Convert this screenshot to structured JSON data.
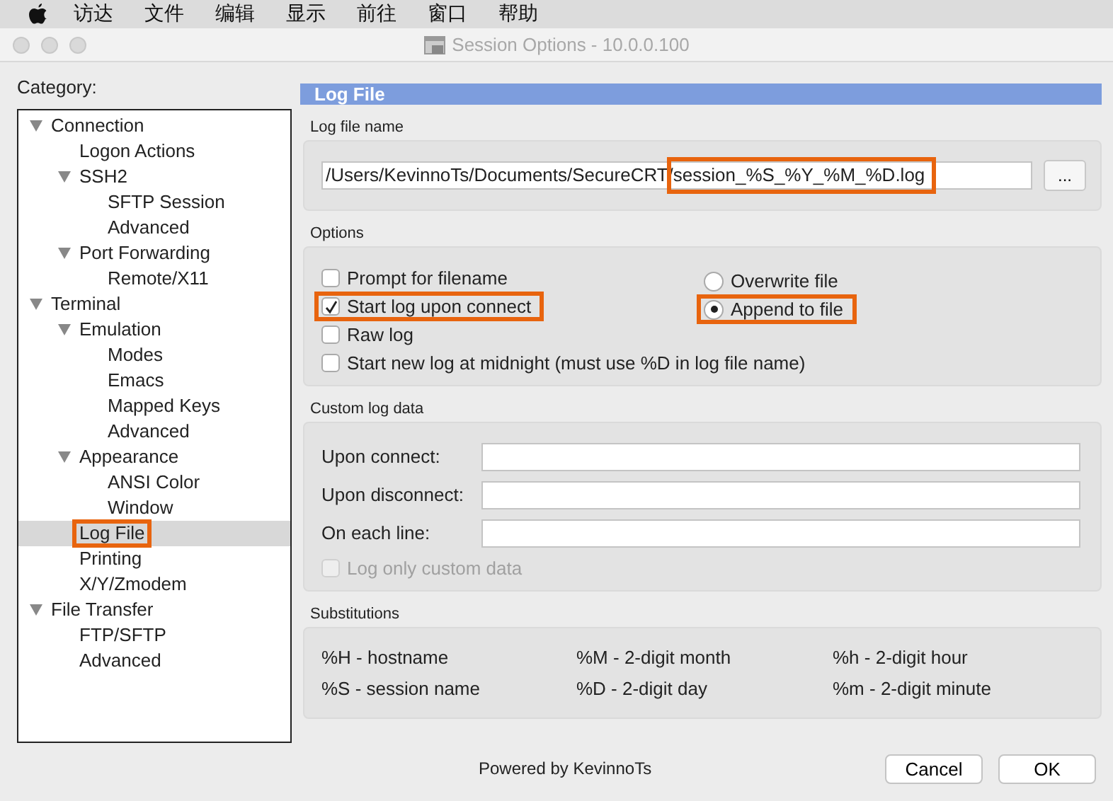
{
  "menu_bar": {
    "items": [
      "访达",
      "文件",
      "编辑",
      "显示",
      "前往",
      "窗口",
      "帮助"
    ]
  },
  "window": {
    "title": "Session Options - 10.0.0.100"
  },
  "category": {
    "label": "Category:",
    "tree": [
      {
        "label": "Connection",
        "expanded": true,
        "selected": false,
        "highlighted": false,
        "children": [
          {
            "label": "Logon Actions",
            "selected": false,
            "highlighted": false
          },
          {
            "label": "SSH2",
            "expanded": true,
            "selected": false,
            "highlighted": false,
            "children": [
              {
                "label": "SFTP Session",
                "selected": false,
                "highlighted": false
              },
              {
                "label": "Advanced",
                "selected": false,
                "highlighted": false
              }
            ]
          },
          {
            "label": "Port Forwarding",
            "expanded": true,
            "selected": false,
            "highlighted": false,
            "children": [
              {
                "label": "Remote/X11",
                "selected": false,
                "highlighted": false
              }
            ]
          }
        ]
      },
      {
        "label": "Terminal",
        "expanded": true,
        "selected": false,
        "highlighted": false,
        "children": [
          {
            "label": "Emulation",
            "expanded": true,
            "selected": false,
            "highlighted": false,
            "children": [
              {
                "label": "Modes",
                "selected": false,
                "highlighted": false
              },
              {
                "label": "Emacs",
                "selected": false,
                "highlighted": false
              },
              {
                "label": "Mapped Keys",
                "selected": false,
                "highlighted": false
              },
              {
                "label": "Advanced",
                "selected": false,
                "highlighted": false
              }
            ]
          },
          {
            "label": "Appearance",
            "expanded": true,
            "selected": false,
            "highlighted": false,
            "children": [
              {
                "label": "ANSI Color",
                "selected": false,
                "highlighted": false
              },
              {
                "label": "Window",
                "selected": false,
                "highlighted": false
              }
            ]
          },
          {
            "label": "Log File",
            "selected": true,
            "highlighted": true
          },
          {
            "label": "Printing",
            "selected": false,
            "highlighted": false
          },
          {
            "label": "X/Y/Zmodem",
            "selected": false,
            "highlighted": false
          }
        ]
      },
      {
        "label": "File Transfer",
        "expanded": true,
        "selected": false,
        "highlighted": false,
        "children": [
          {
            "label": "FTP/SFTP",
            "selected": false,
            "highlighted": false
          },
          {
            "label": "Advanced",
            "selected": false,
            "highlighted": false
          }
        ]
      }
    ]
  },
  "panel": {
    "title": "Log File",
    "log_file_name": {
      "label": "Log file name",
      "value": "/Users/KevinnoTs/Documents/SecureCRT/session_%S_%Y_%M_%D.log",
      "highlighted": true,
      "browse_button": "..."
    },
    "options": {
      "label": "Options",
      "checkboxes": [
        {
          "label": "Prompt for filename",
          "checked": false,
          "highlighted": false
        },
        {
          "label": "Start log upon connect",
          "checked": true,
          "highlighted": true
        },
        {
          "label": "Raw log",
          "checked": false,
          "highlighted": false
        },
        {
          "label": "Start new log at midnight (must use %D in log file name)",
          "checked": false,
          "highlighted": false
        }
      ],
      "radios": [
        {
          "label": "Overwrite file",
          "selected": false,
          "highlighted": false
        },
        {
          "label": "Append to file",
          "selected": true,
          "highlighted": true
        }
      ]
    },
    "custom_log_data": {
      "label": "Custom log data",
      "fields": [
        {
          "label": "Upon connect:"
        },
        {
          "label": "Upon disconnect:"
        },
        {
          "label": "On each line:"
        }
      ],
      "log_only_custom": {
        "label": "Log only custom data",
        "checked": false,
        "disabled": true
      }
    },
    "substitutions": {
      "label": "Substitutions",
      "items": [
        "%H - hostname",
        "%M - 2-digit month",
        "%h - 2-digit hour",
        "%S - session name",
        "%D - 2-digit day",
        "%m - 2-digit minute"
      ]
    }
  },
  "footer": {
    "text": "Powered by KevinnoTs",
    "buttons": [
      "Cancel",
      "OK"
    ]
  }
}
